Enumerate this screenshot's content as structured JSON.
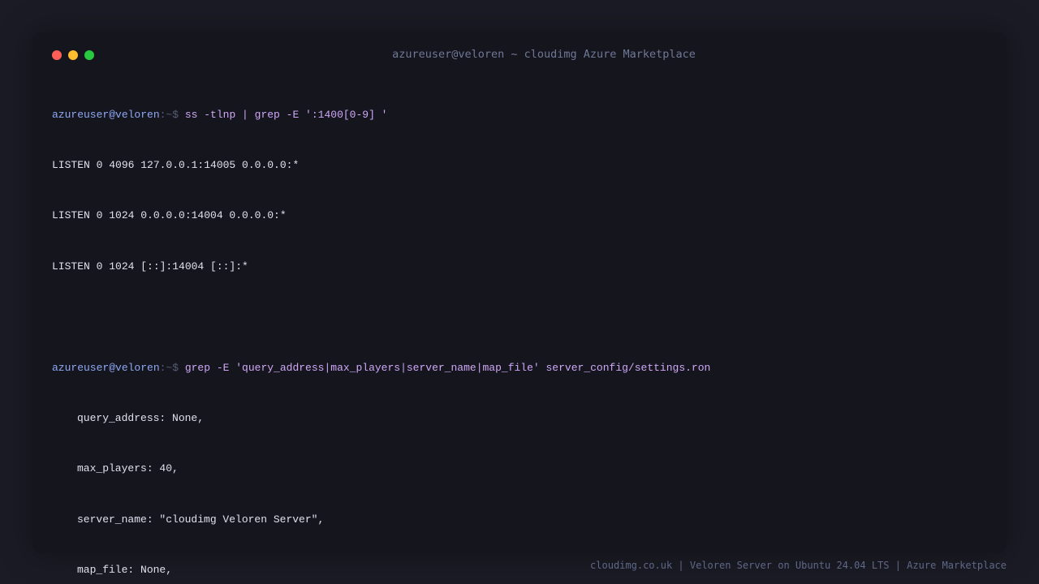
{
  "window": {
    "title": "azureuser@veloren ~ cloudimg Azure Marketplace"
  },
  "terminal": {
    "blocks": [
      {
        "prompt_user": "azureuser@veloren",
        "prompt_path": ":~$",
        "command": " ss -tlnp | grep -E ':1400[0-9] '",
        "output": [
          "LISTEN 0 4096 127.0.0.1:14005 0.0.0.0:*",
          "LISTEN 0 1024 0.0.0.0:14004 0.0.0.0:*",
          "LISTEN 0 1024 [::]:14004 [::]:*"
        ]
      },
      {
        "prompt_user": "azureuser@veloren",
        "prompt_path": ":~$",
        "command": " grep -E 'query_address|max_players|server_name|map_file' server_config/settings.ron",
        "output": [
          "query_address: None,",
          "max_players: 40,",
          "server_name: \"cloudimg Veloren Server\",",
          "map_file: None,"
        ]
      }
    ]
  },
  "footer": {
    "text": "cloudimg.co.uk | Veloren Server on Ubuntu 24.04 LTS | Azure Marketplace"
  },
  "colors": {
    "background": "#1b1b25",
    "window": "#15151e",
    "prompt_user": "#8fa8f4",
    "command": "#cfa8f7",
    "close": "#ff5f57",
    "minimize": "#febc2e",
    "maximize": "#28c840"
  }
}
